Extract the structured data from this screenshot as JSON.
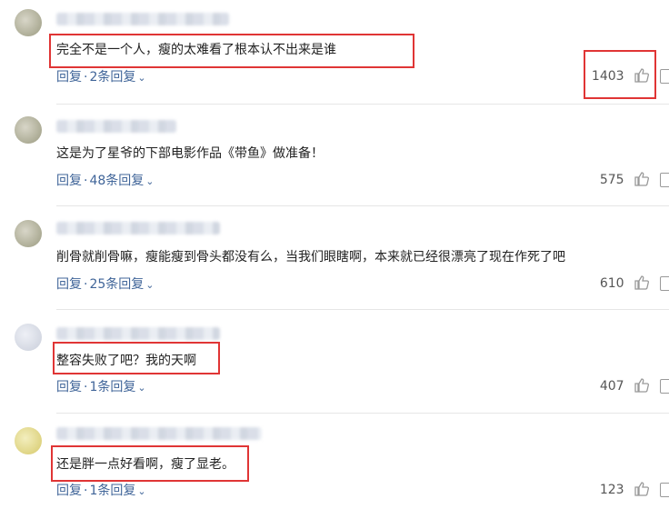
{
  "comments": [
    {
      "text": "完全不是一个人，瘦的太难看了根本认不出来是谁",
      "reply_label": "回复",
      "replies": "2条回复",
      "likes": "1403"
    },
    {
      "text": "这是为了星爷的下部电影作品《带鱼》做准备！",
      "reply_label": "回复",
      "replies": "48条回复",
      "likes": "575"
    },
    {
      "text": "削骨就削骨嘛，瘦能瘦到骨头都没有么，当我们眼瞎啊，本来就已经很漂亮了现在作死了吧",
      "reply_label": "回复",
      "replies": "25条回复",
      "likes": "610"
    },
    {
      "text": "整容失败了吧？我的天啊",
      "reply_label": "回复",
      "replies": "1条回复",
      "likes": "407"
    },
    {
      "text": "还是胖一点好看啊，瘦了显老。",
      "reply_label": "回复",
      "replies": "1条回复",
      "likes": "123"
    }
  ],
  "colors": {
    "highlight": "#e03535",
    "link": "#406599"
  },
  "icons": {
    "like": "thumbs-up-icon",
    "more": "more-icon",
    "dropdown": "chevron-down-icon"
  }
}
